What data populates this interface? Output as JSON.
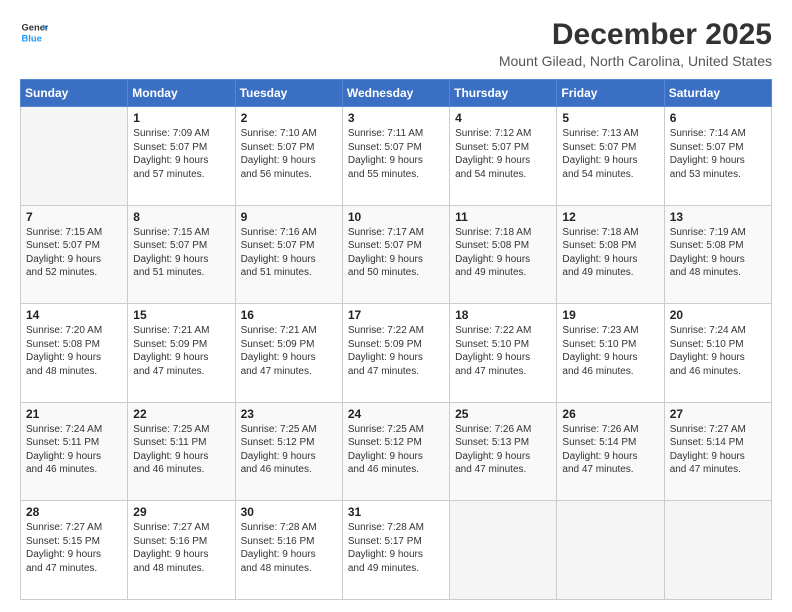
{
  "logo": {
    "line1": "General",
    "line2": "Blue"
  },
  "title": "December 2025",
  "subtitle": "Mount Gilead, North Carolina, United States",
  "header_days": [
    "Sunday",
    "Monday",
    "Tuesday",
    "Wednesday",
    "Thursday",
    "Friday",
    "Saturday"
  ],
  "weeks": [
    [
      {
        "num": "",
        "info": ""
      },
      {
        "num": "1",
        "info": "Sunrise: 7:09 AM\nSunset: 5:07 PM\nDaylight: 9 hours\nand 57 minutes."
      },
      {
        "num": "2",
        "info": "Sunrise: 7:10 AM\nSunset: 5:07 PM\nDaylight: 9 hours\nand 56 minutes."
      },
      {
        "num": "3",
        "info": "Sunrise: 7:11 AM\nSunset: 5:07 PM\nDaylight: 9 hours\nand 55 minutes."
      },
      {
        "num": "4",
        "info": "Sunrise: 7:12 AM\nSunset: 5:07 PM\nDaylight: 9 hours\nand 54 minutes."
      },
      {
        "num": "5",
        "info": "Sunrise: 7:13 AM\nSunset: 5:07 PM\nDaylight: 9 hours\nand 54 minutes."
      },
      {
        "num": "6",
        "info": "Sunrise: 7:14 AM\nSunset: 5:07 PM\nDaylight: 9 hours\nand 53 minutes."
      }
    ],
    [
      {
        "num": "7",
        "info": "Sunrise: 7:15 AM\nSunset: 5:07 PM\nDaylight: 9 hours\nand 52 minutes."
      },
      {
        "num": "8",
        "info": "Sunrise: 7:15 AM\nSunset: 5:07 PM\nDaylight: 9 hours\nand 51 minutes."
      },
      {
        "num": "9",
        "info": "Sunrise: 7:16 AM\nSunset: 5:07 PM\nDaylight: 9 hours\nand 51 minutes."
      },
      {
        "num": "10",
        "info": "Sunrise: 7:17 AM\nSunset: 5:07 PM\nDaylight: 9 hours\nand 50 minutes."
      },
      {
        "num": "11",
        "info": "Sunrise: 7:18 AM\nSunset: 5:08 PM\nDaylight: 9 hours\nand 49 minutes."
      },
      {
        "num": "12",
        "info": "Sunrise: 7:18 AM\nSunset: 5:08 PM\nDaylight: 9 hours\nand 49 minutes."
      },
      {
        "num": "13",
        "info": "Sunrise: 7:19 AM\nSunset: 5:08 PM\nDaylight: 9 hours\nand 48 minutes."
      }
    ],
    [
      {
        "num": "14",
        "info": "Sunrise: 7:20 AM\nSunset: 5:08 PM\nDaylight: 9 hours\nand 48 minutes."
      },
      {
        "num": "15",
        "info": "Sunrise: 7:21 AM\nSunset: 5:09 PM\nDaylight: 9 hours\nand 47 minutes."
      },
      {
        "num": "16",
        "info": "Sunrise: 7:21 AM\nSunset: 5:09 PM\nDaylight: 9 hours\nand 47 minutes."
      },
      {
        "num": "17",
        "info": "Sunrise: 7:22 AM\nSunset: 5:09 PM\nDaylight: 9 hours\nand 47 minutes."
      },
      {
        "num": "18",
        "info": "Sunrise: 7:22 AM\nSunset: 5:10 PM\nDaylight: 9 hours\nand 47 minutes."
      },
      {
        "num": "19",
        "info": "Sunrise: 7:23 AM\nSunset: 5:10 PM\nDaylight: 9 hours\nand 46 minutes."
      },
      {
        "num": "20",
        "info": "Sunrise: 7:24 AM\nSunset: 5:10 PM\nDaylight: 9 hours\nand 46 minutes."
      }
    ],
    [
      {
        "num": "21",
        "info": "Sunrise: 7:24 AM\nSunset: 5:11 PM\nDaylight: 9 hours\nand 46 minutes."
      },
      {
        "num": "22",
        "info": "Sunrise: 7:25 AM\nSunset: 5:11 PM\nDaylight: 9 hours\nand 46 minutes."
      },
      {
        "num": "23",
        "info": "Sunrise: 7:25 AM\nSunset: 5:12 PM\nDaylight: 9 hours\nand 46 minutes."
      },
      {
        "num": "24",
        "info": "Sunrise: 7:25 AM\nSunset: 5:12 PM\nDaylight: 9 hours\nand 46 minutes."
      },
      {
        "num": "25",
        "info": "Sunrise: 7:26 AM\nSunset: 5:13 PM\nDaylight: 9 hours\nand 47 minutes."
      },
      {
        "num": "26",
        "info": "Sunrise: 7:26 AM\nSunset: 5:14 PM\nDaylight: 9 hours\nand 47 minutes."
      },
      {
        "num": "27",
        "info": "Sunrise: 7:27 AM\nSunset: 5:14 PM\nDaylight: 9 hours\nand 47 minutes."
      }
    ],
    [
      {
        "num": "28",
        "info": "Sunrise: 7:27 AM\nSunset: 5:15 PM\nDaylight: 9 hours\nand 47 minutes."
      },
      {
        "num": "29",
        "info": "Sunrise: 7:27 AM\nSunset: 5:16 PM\nDaylight: 9 hours\nand 48 minutes."
      },
      {
        "num": "30",
        "info": "Sunrise: 7:28 AM\nSunset: 5:16 PM\nDaylight: 9 hours\nand 48 minutes."
      },
      {
        "num": "31",
        "info": "Sunrise: 7:28 AM\nSunset: 5:17 PM\nDaylight: 9 hours\nand 49 minutes."
      },
      {
        "num": "",
        "info": ""
      },
      {
        "num": "",
        "info": ""
      },
      {
        "num": "",
        "info": ""
      }
    ]
  ]
}
